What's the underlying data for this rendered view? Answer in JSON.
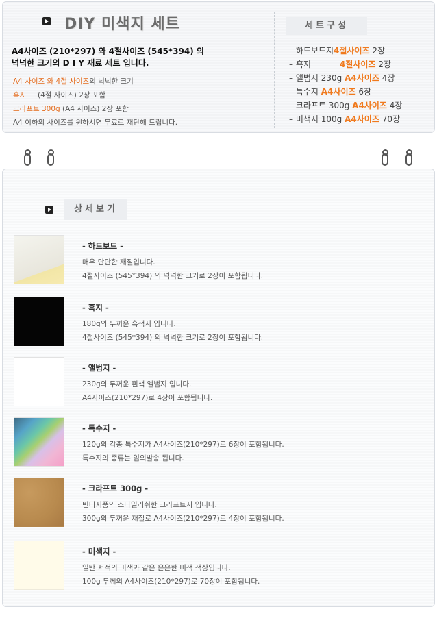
{
  "header": {
    "title": "DIY 미색지 세트",
    "headline_line1": "A4사이즈 (210*297) 와 4절사이즈 (545*394) 의",
    "headline_line2": "넉넉한 크기의 D I Y 재료 세트 입니다."
  },
  "description": [
    {
      "pre": "A4 사이즈 와 4절 사이즈",
      "post": "의 넉넉한 크기"
    },
    {
      "pre": "흑지",
      "post": "     (4절 사이즈) 2장 포함"
    },
    {
      "pre": "크라프트 300g",
      "post": " (A4 사이즈) 2장 포함"
    },
    {
      "pre": "",
      "post": "A4 이하의 사이즈를 원하시면 무료로 재단해 드립니다."
    }
  ],
  "composition": {
    "title": "세트구성",
    "items": [
      {
        "name": "하드보드지",
        "size": "4절사이즈",
        "qty": "2장"
      },
      {
        "name": "흑지",
        "size": "4절사이즈",
        "qty": "2장"
      },
      {
        "name": "앨범지 230g",
        "size": "A4사이즈",
        "qty": "4장"
      },
      {
        "name": "특수지",
        "size": "A4사이즈",
        "qty": "6장"
      },
      {
        "name": "크라프트 300g",
        "size": "A4사이즈",
        "qty": "4장"
      },
      {
        "name": "미색지 100g",
        "size": "A4사이즈",
        "qty": "70장"
      }
    ]
  },
  "detail": {
    "title": "상세보기",
    "items": [
      {
        "title": "- 하드보드 -",
        "line1": "매우 단단한 재질입니다.",
        "line2": "4절사이즈 (545*394) 의 넉넉한 크기로 2장이 포함됩니다."
      },
      {
        "title": "- 흑지 -",
        "line1": "180g의 두꺼운 흑색지 입니다.",
        "line2": "4절사이즈 (545*394) 의 넉넉한 크기로 2장이 포함됩니다."
      },
      {
        "title": "- 앨범지 -",
        "line1": "230g의 두꺼운 흰색 앨범지 입니다.",
        "line2": "A4사이즈(210*297)로 4장이 포함됩니다."
      },
      {
        "title": "- 특수지 -",
        "line1": "120g의 각종 특수지가 A4사이즈(210*297)로 6장이  포함됩니다.",
        "line2": "특수지의 종류는 임의발송 됩니다."
      },
      {
        "title": "- 크라프트 300g -",
        "line1": "빈티지풍의 스타일리쉬한 크라프트지 입니다.",
        "line2": "300g의 두꺼운 재질로 A4사이즈(210*297)로 4장이 포함됩니다."
      },
      {
        "title": "- 미색지 -",
        "line1": "일반 서적의 미색과 같은 은은한 미색 색상입니다.",
        "line2": "100g 두께의 A4사이즈(210*297)로 70장이 포함됩니다."
      }
    ]
  },
  "colors": {
    "accent": "#f07a1e",
    "panel": "#f7f8fa"
  }
}
